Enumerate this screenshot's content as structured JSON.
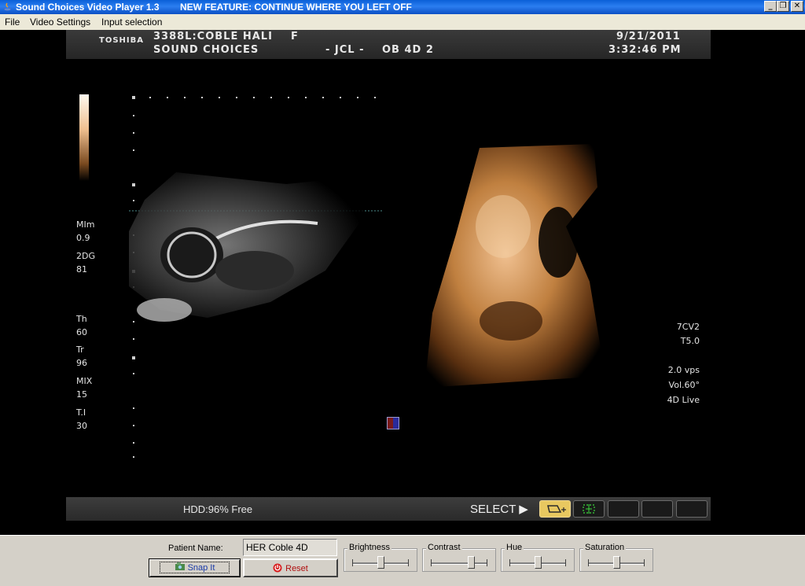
{
  "window": {
    "title": "Sound Choices Video Player 1.3",
    "feature_notice": "NEW FEATURE:  CONTINUE WHERE YOU LEFT OFF",
    "controls": {
      "minimize": "_",
      "restore": "❐",
      "close": "✕"
    }
  },
  "menu": [
    "File",
    "Video Settings",
    "Input selection"
  ],
  "ultrasound": {
    "brand": "TOSHIBA",
    "patient_line": "3388L:COBLE HALI",
    "sex": "F",
    "studio": "SOUND CHOICES",
    "operator": "- JCL -",
    "mode": "OB 4D 2",
    "date": "9/21/2011",
    "time": "3:32:46 PM",
    "left_params": [
      {
        "label": "MIm",
        "value": "0.9"
      },
      {
        "label": "2DG",
        "value": "81"
      },
      {
        "label": "Th",
        "value": "60"
      },
      {
        "label": "Tr",
        "value": "96"
      },
      {
        "label": "MIX",
        "value": "15"
      },
      {
        "label": "T.I",
        "value": "30"
      }
    ],
    "right_params": [
      "7CV2",
      "T5.0",
      "2.0 vps",
      "Vol.60°",
      "4D Live"
    ],
    "hdd": "HDD:96% Free",
    "select": "SELECT ▶"
  },
  "controls": {
    "patient_name_label": "Patient Name:",
    "patient_name_value": "HER Coble 4D",
    "snap_label": "Snap It",
    "reset_label": "Reset",
    "sliders": [
      {
        "name": "Brightness",
        "value": 0.5
      },
      {
        "name": "Contrast",
        "value": 0.75
      },
      {
        "name": "Hue",
        "value": 0.5
      },
      {
        "name": "Saturation",
        "value": 0.5
      }
    ]
  }
}
